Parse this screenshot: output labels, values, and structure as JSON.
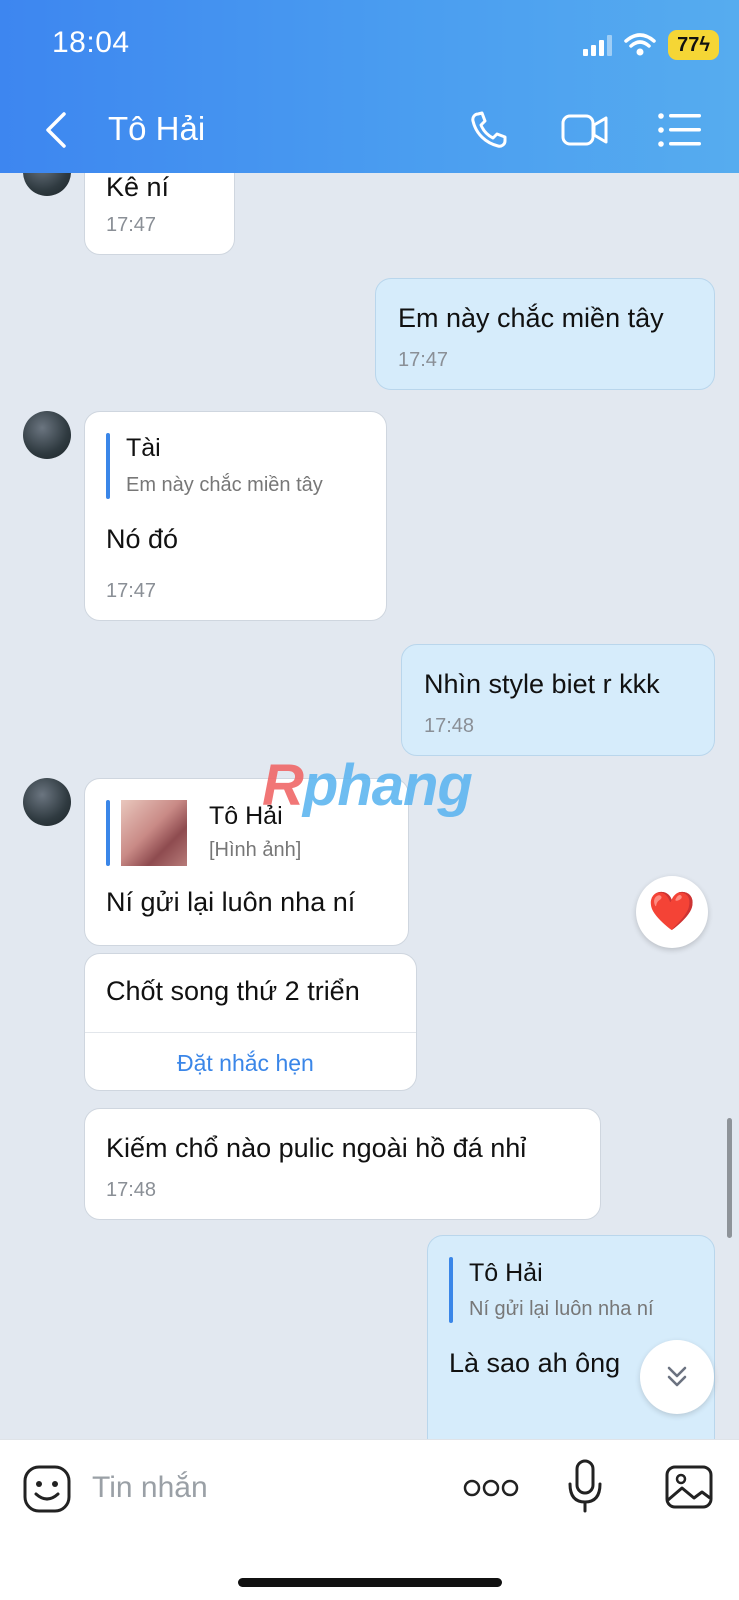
{
  "status_bar": {
    "time": "18:04",
    "battery": "77"
  },
  "header": {
    "contact_name": "Tô Hải"
  },
  "messages": [
    {
      "text": "Kê ní",
      "time": "17:47"
    },
    {
      "text": "Em này chắc miền tây",
      "time": "17:47"
    },
    {
      "quote_author": "Tài",
      "quote_text": "Em này chắc miền tây",
      "text": "Nó đó",
      "time": "17:47"
    },
    {
      "text": "Nhìn style biet r kkk",
      "time": "17:48"
    },
    {
      "quote_author": "Tô Hải",
      "quote_text": "[Hình ảnh]",
      "text": "Ní gửi lại luôn nha ní"
    },
    {
      "text": "Chốt song thứ 2 triển",
      "action_label": "Đặt nhắc hẹn"
    },
    {
      "text": "Kiếm chổ nào pulic ngoài hồ đá nhỉ",
      "time": "17:48"
    },
    {
      "quote_author": "Tô Hải",
      "quote_text": "Ní gửi lại luôn nha ní",
      "text": "Là sao ah ông"
    }
  ],
  "watermark": {
    "first": "R",
    "rest": "phang"
  },
  "reaction": {
    "emoji": "❤️"
  },
  "input": {
    "placeholder": "Tin nhắn"
  },
  "colors": {
    "header_start": "#3d86f0",
    "header_end": "#56acef",
    "accent": "#3a86e8",
    "outgoing_bubble": "#d6ecfb",
    "chat_bg": "#e2e8f0"
  }
}
